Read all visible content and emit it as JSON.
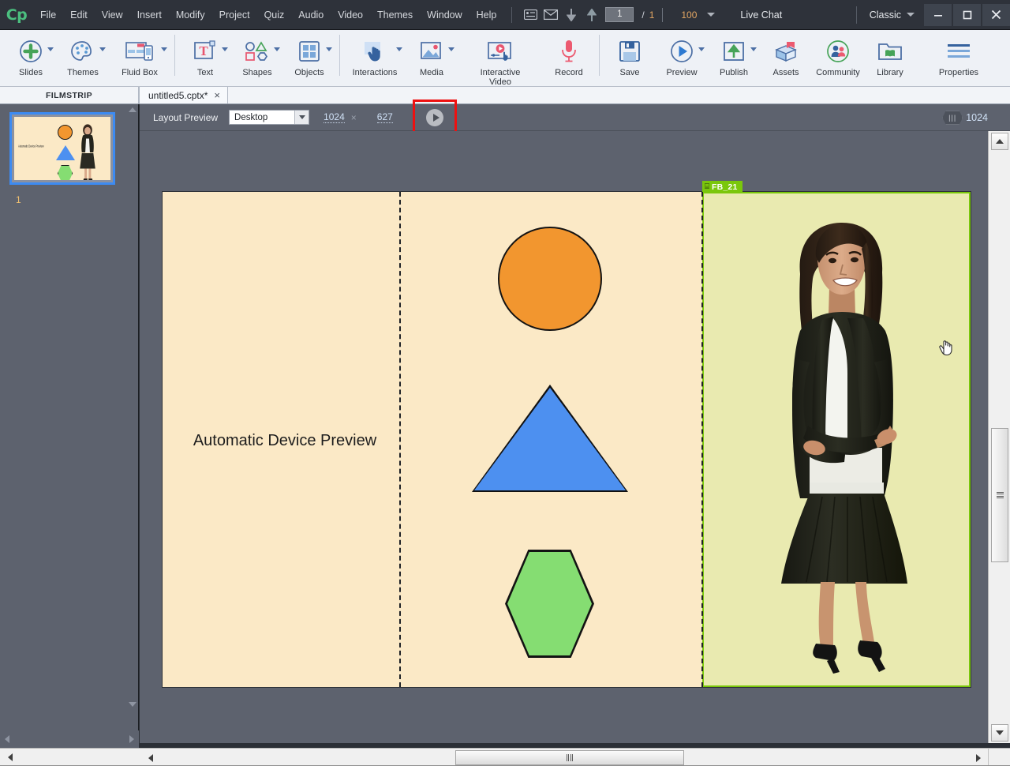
{
  "app": {
    "logo": "Cp",
    "window_controls": {
      "minimize": "—",
      "maximize": "❐",
      "close": "✕"
    }
  },
  "menubar": {
    "items": [
      {
        "label": "File"
      },
      {
        "label": "Edit"
      },
      {
        "label": "View"
      },
      {
        "label": "Insert"
      },
      {
        "label": "Modify"
      },
      {
        "label": "Project"
      },
      {
        "label": "Quiz"
      },
      {
        "label": "Audio"
      },
      {
        "label": "Video"
      },
      {
        "label": "Themes"
      },
      {
        "label": "Window"
      },
      {
        "label": "Help"
      }
    ],
    "icons": [
      {
        "name": "slide-notes-icon",
        "glyph": "☰"
      },
      {
        "name": "mail-icon",
        "glyph": "✉"
      },
      {
        "name": "move-down-icon",
        "glyph": "↓"
      },
      {
        "name": "move-up-icon",
        "glyph": "↑"
      }
    ],
    "current_page": "1",
    "page_separator": "/",
    "total_pages": "1",
    "zoom_value": "100",
    "live_chat": "Live Chat",
    "workspace": "Classic"
  },
  "ribbon": {
    "groups": [
      {
        "label": "Slides",
        "icon": "add-slide-icon",
        "has_dropdown": true
      },
      {
        "label": "Themes",
        "icon": "palette-icon",
        "has_dropdown": true
      },
      {
        "label": "Fluid Box",
        "icon": "fluid-box-icon",
        "has_dropdown": true
      },
      {
        "label": "Text",
        "icon": "text-icon",
        "has_dropdown": true
      },
      {
        "label": "Shapes",
        "icon": "shapes-icon",
        "has_dropdown": true
      },
      {
        "label": "Objects",
        "icon": "objects-grid-icon",
        "has_dropdown": true
      },
      {
        "label": "Interactions",
        "icon": "interactions-hand-icon",
        "has_dropdown": true
      },
      {
        "label": "Media",
        "icon": "media-image-icon",
        "has_dropdown": true
      },
      {
        "label": "Interactive Video",
        "icon": "interactive-video-icon",
        "has_dropdown": false
      },
      {
        "label": "Record",
        "icon": "microphone-icon",
        "has_dropdown": false
      },
      {
        "label": "Save",
        "icon": "floppy-save-icon",
        "has_dropdown": false
      },
      {
        "label": "Preview",
        "icon": "play-circle-icon",
        "has_dropdown": true
      },
      {
        "label": "Publish",
        "icon": "publish-upload-icon",
        "has_dropdown": true
      },
      {
        "label": "Assets",
        "icon": "assets-box-icon",
        "has_dropdown": false
      },
      {
        "label": "Community",
        "icon": "community-people-icon",
        "has_dropdown": false
      },
      {
        "label": "Library",
        "icon": "library-folder-icon",
        "has_dropdown": false
      },
      {
        "label": "Properties",
        "icon": "properties-lines-icon",
        "has_dropdown": false
      }
    ]
  },
  "tabs": {
    "filmstrip_label": "FILMSTRIP",
    "document_tab": {
      "label": "untitled5.cptx*",
      "close_glyph": "×"
    }
  },
  "filmstrip": {
    "slide_number": "1",
    "thumbnail_text": "Automatic Device Preview"
  },
  "layout_preview": {
    "label": "Layout Preview",
    "device": "Desktop",
    "width": "1024",
    "x_symbol": "×",
    "height": "627",
    "play_button": "play-preview-button",
    "right_width": "1024",
    "handle_grip": "|||"
  },
  "stage": {
    "text_block": "Automatic Device Preview",
    "fluid_box": {
      "name": "FB_21",
      "icon_glyph": "⌸"
    },
    "shapes": [
      {
        "name": "circle",
        "color": "#F2962F"
      },
      {
        "name": "triangle",
        "color": "#4D90F0"
      },
      {
        "name": "hexagon",
        "color": "#85DD72"
      }
    ],
    "background_color": "#FBE9C6",
    "fluid_box_fill": "#E9EAB0",
    "fluid_box_border": "#7AC70C"
  },
  "colors": {
    "menubar_bg": "#2E323A",
    "ribbon_bg": "#EEF1F6",
    "panel_bg": "#5D626E",
    "accent_blue": "#4C6FA5",
    "highlight_red": "#EE1111",
    "accent_green": "#4BBF7F"
  }
}
